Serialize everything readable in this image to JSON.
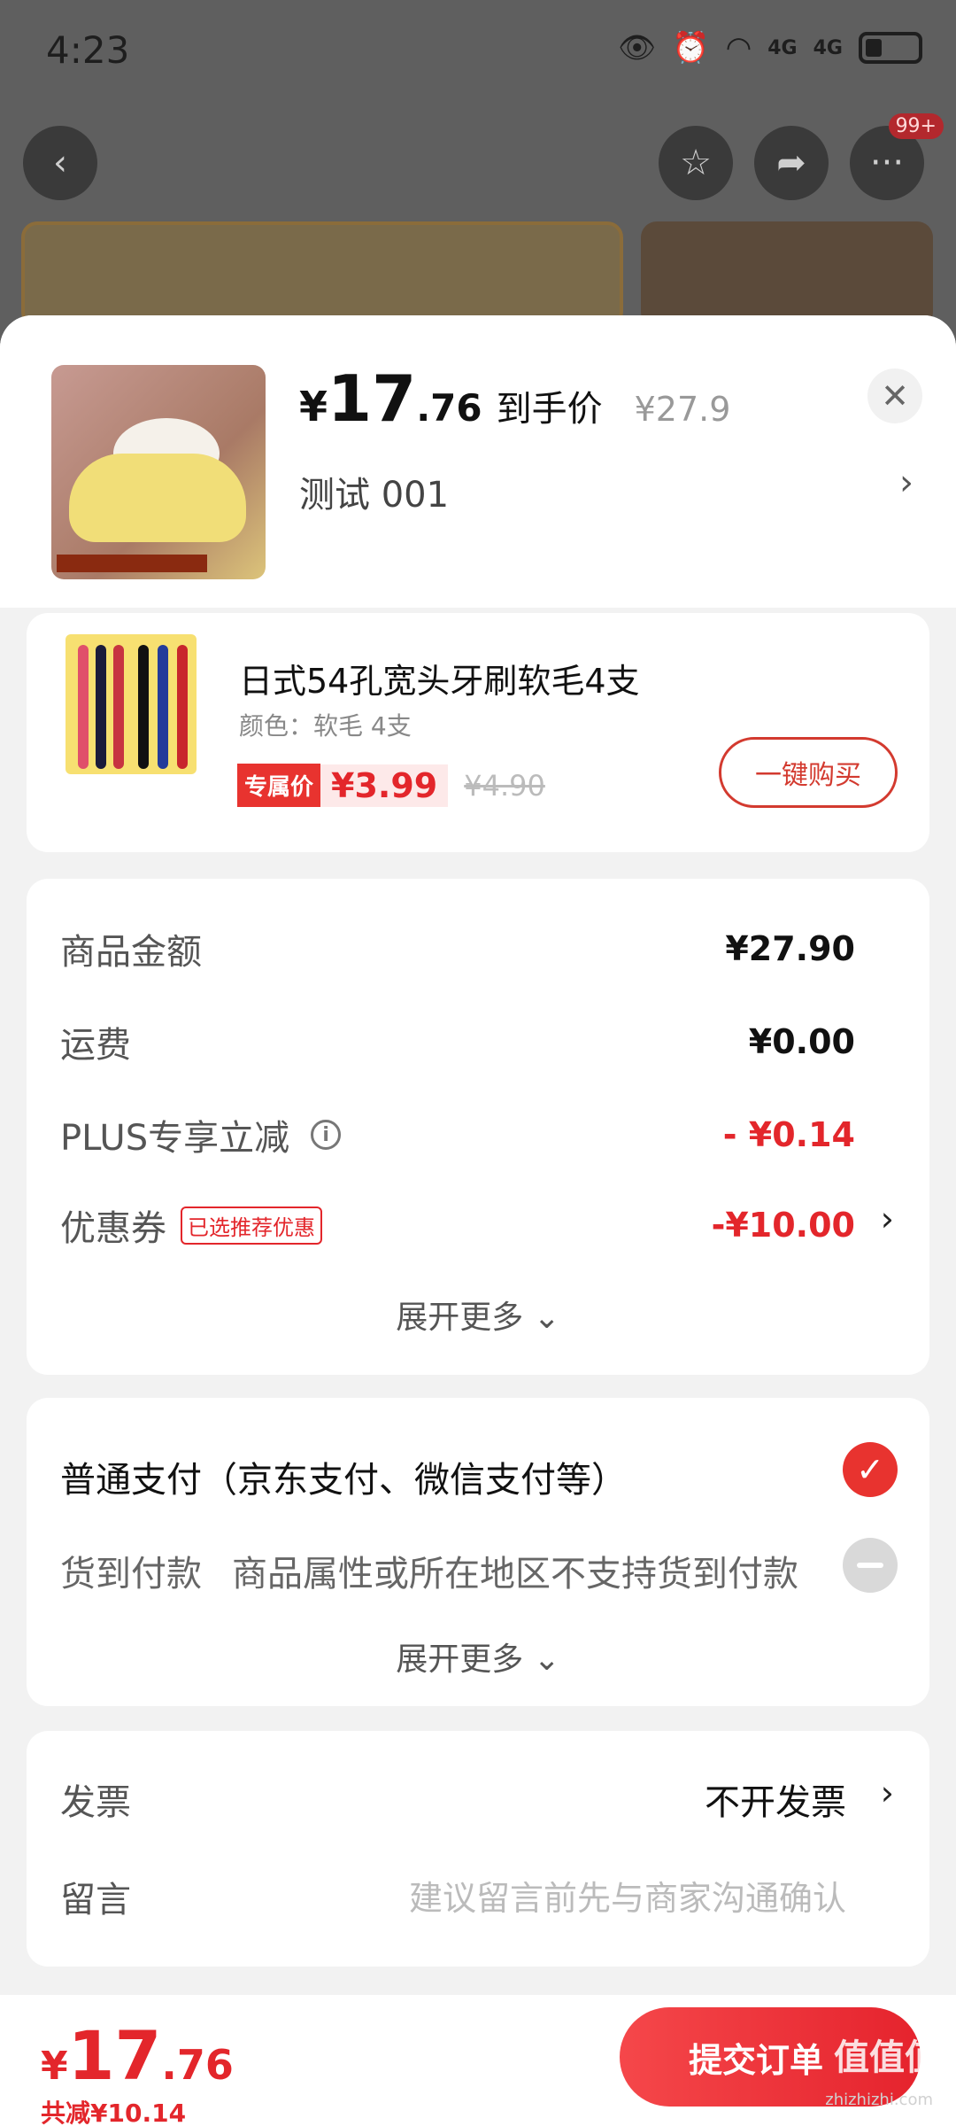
{
  "status_bar": {
    "time": "4:23",
    "network": "4G"
  },
  "background_page": {
    "more_badge": "99+"
  },
  "product": {
    "price_symbol": "¥",
    "price_int": "17",
    "price_dec": ".76",
    "price_label": "到手价",
    "original_price": "¥27.9",
    "variant": "测试  001"
  },
  "addon": {
    "title": "日式54孔宽头牙刷软毛4支",
    "subtitle": "颜色：软毛 4支",
    "exclusive_tag": "专属价",
    "price": "¥3.99",
    "original_price": "¥4.90",
    "buy_button": "一键购买"
  },
  "summary": {
    "rows": [
      {
        "label": "商品金额",
        "value": "¥27.90"
      },
      {
        "label": "运费",
        "value": "¥0.00"
      },
      {
        "label": "PLUS专享立减",
        "value": "- ¥0.14"
      },
      {
        "label": "优惠券",
        "tag": "已选推荐优惠",
        "value": "-¥10.00"
      }
    ],
    "expand": "展开更多 ⌄"
  },
  "payment": {
    "normal": "普通支付（京东支付、微信支付等）",
    "cod_label": "货到付款",
    "cod_note": "商品属性或所在地区不支持货到付款",
    "expand": "展开更多 ⌄"
  },
  "extra": {
    "invoice_label": "发票",
    "invoice_value": "不开发票",
    "message_label": "留言",
    "message_placeholder": "建议留言前先与商家沟通确认"
  },
  "footer": {
    "symbol": "¥",
    "total_int": "17",
    "total_dec": ".76",
    "saved": "共减¥10.14",
    "submit": "提交订单",
    "watermark": "值值值",
    "watermark_sub": "zhizhizhi.com"
  },
  "colors": {
    "accent": "#e3262b",
    "button": "#e8332f"
  }
}
